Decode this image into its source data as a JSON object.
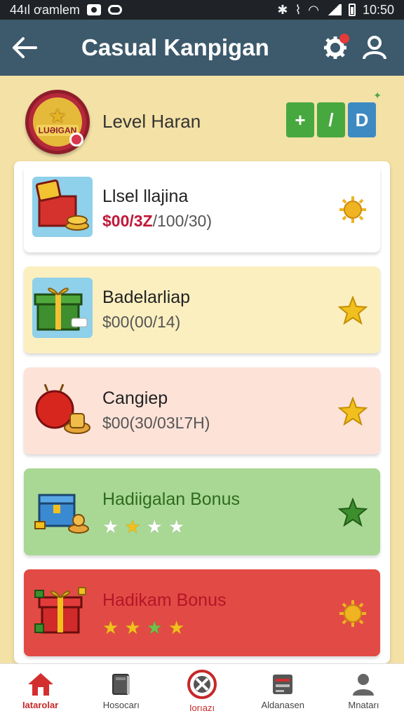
{
  "status_bar": {
    "left_text": "44ıl ơamlem",
    "time": "10:50"
  },
  "app_bar": {
    "title": "Casual Kanpigan"
  },
  "level": {
    "badge_text": "LUƏIGAN",
    "label": "Level Haran",
    "controls": [
      "+",
      "/",
      "D"
    ]
  },
  "cards": [
    {
      "title": "Llsel llajina",
      "sub_red": "$00/3Z",
      "sub_rest": "/100/30)",
      "bg": "#ffffff",
      "title_color": "#222222",
      "icon": "sun-badge-icon"
    },
    {
      "title": "Badelarliap",
      "sub_red": "",
      "sub_rest": "$00(00/14)",
      "bg": "#fbefc0",
      "title_color": "#222222",
      "icon": "star-icon"
    },
    {
      "title": "Cangiep",
      "sub_red": "",
      "sub_rest": "$00(30/03Ľ7H)",
      "bg": "#fde2d8",
      "title_color": "#222222",
      "icon": "star-icon"
    },
    {
      "title": "Hadiigalan Bonus",
      "stars": [
        "white",
        "gold",
        "white",
        "white"
      ],
      "bg": "#a8d894",
      "title_color": "#2f6b1f",
      "icon": "green-star-icon"
    },
    {
      "title": "Hadikam Bonus",
      "stars": [
        "gold",
        "gold",
        "green",
        "gold"
      ],
      "bg": "#e24b45",
      "title_color": "#b41528",
      "icon": "sun-badge-icon"
    }
  ],
  "bottom_nav": {
    "items": [
      {
        "label": "Iatarolar",
        "icon": "home-icon",
        "active": true
      },
      {
        "label": "Hosocarı",
        "icon": "book-icon",
        "active": false
      },
      {
        "label": "Iorıazı",
        "icon": "no-entry-icon",
        "active": false
      },
      {
        "label": "Aldanasen",
        "icon": "tools-icon",
        "active": false
      },
      {
        "label": "Mnatarı",
        "icon": "person-icon",
        "active": false
      }
    ]
  }
}
